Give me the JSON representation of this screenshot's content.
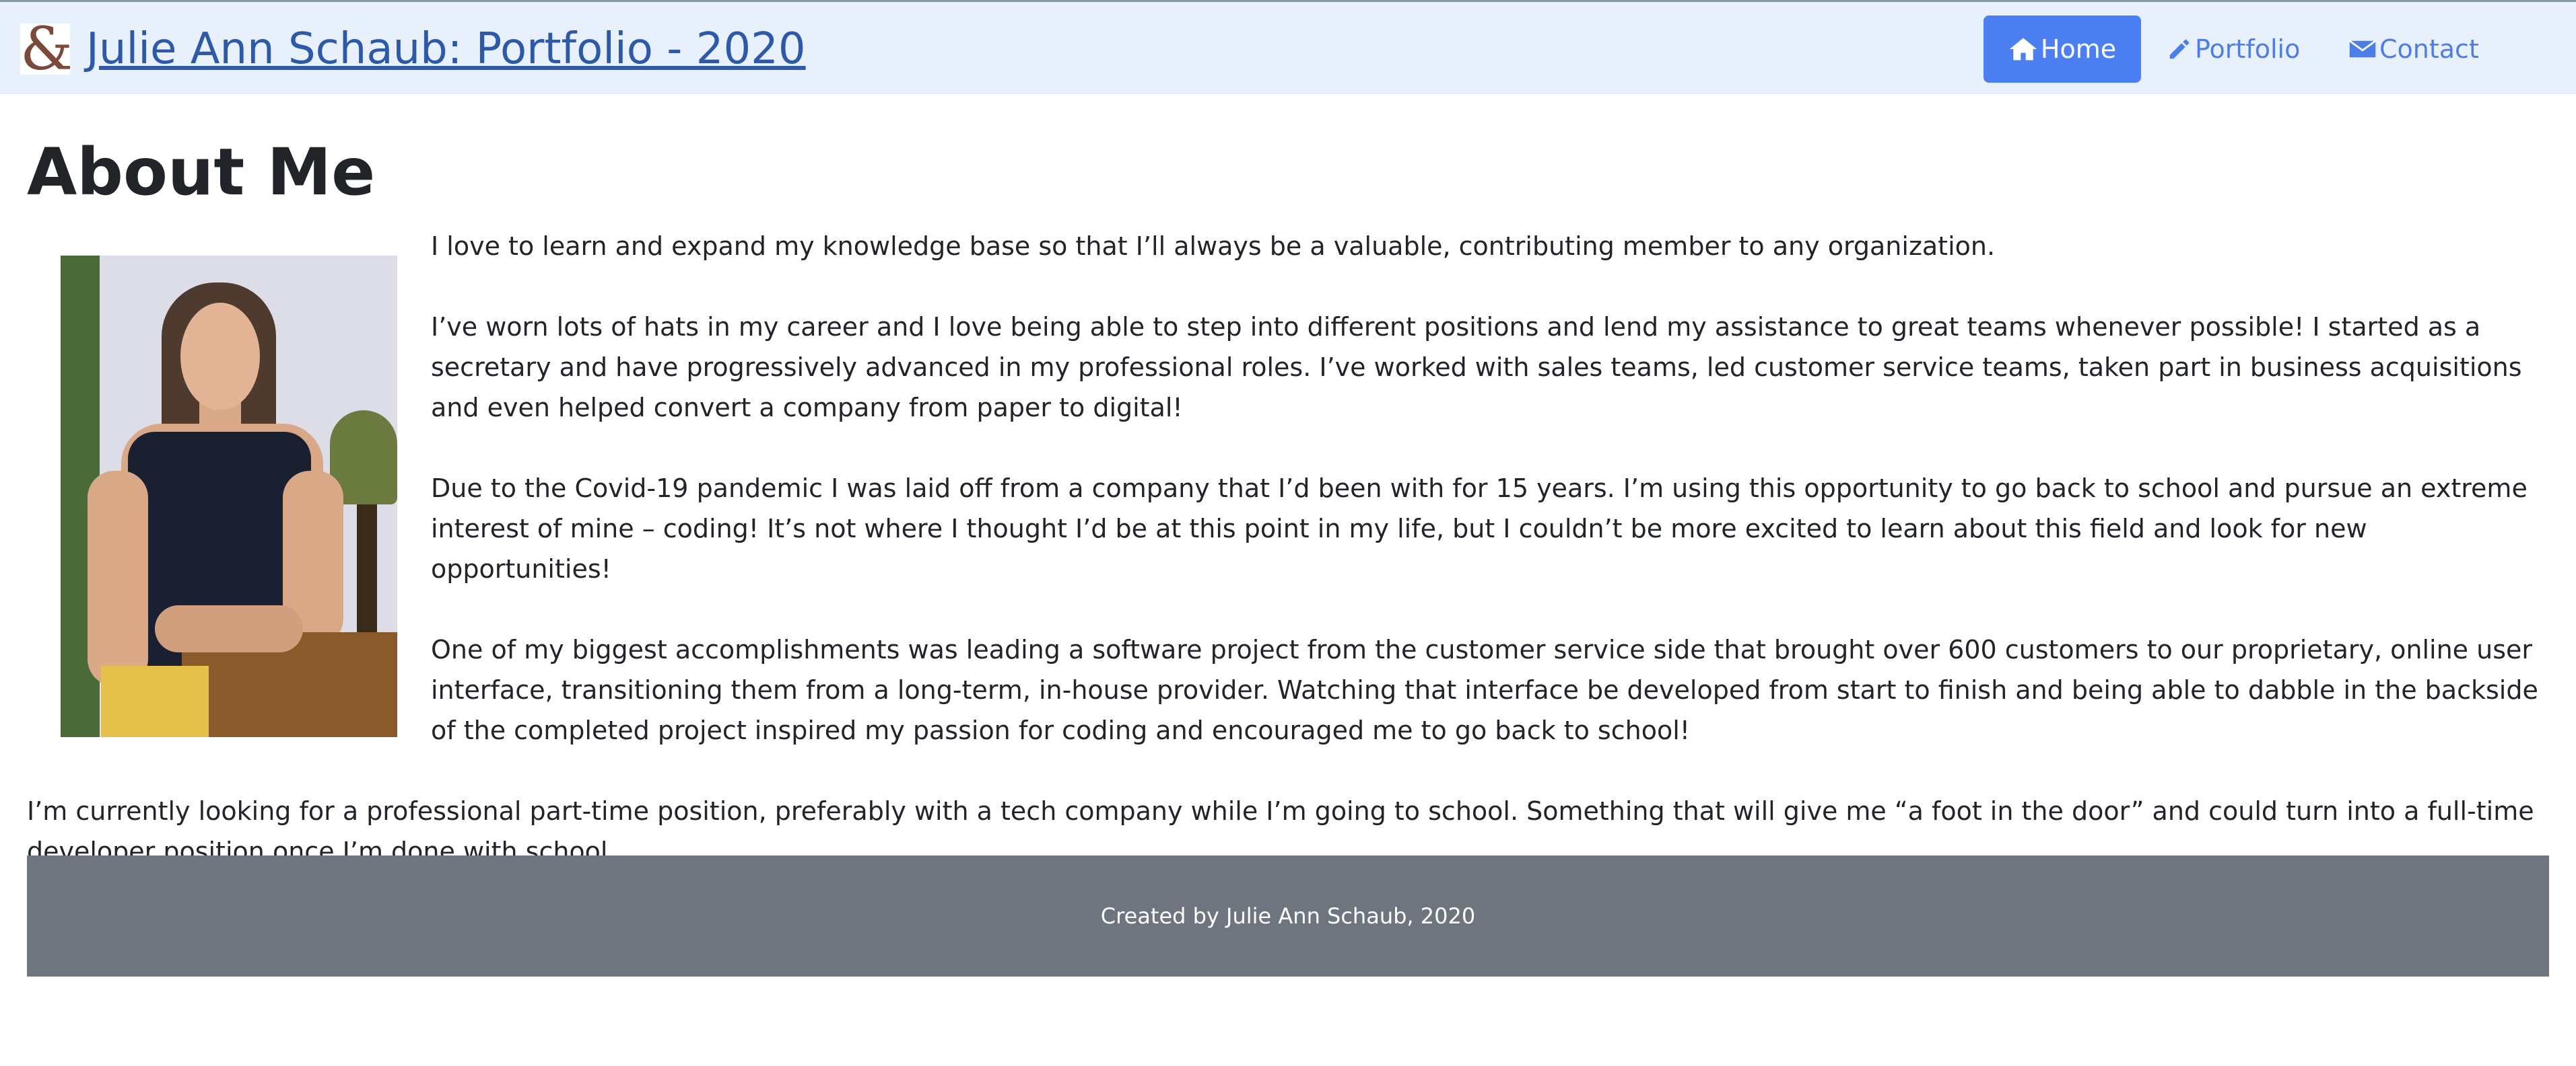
{
  "header": {
    "brand_logo_text": "&",
    "title": "Julie Ann Schaub: Portfolio - 2020"
  },
  "nav": {
    "items": [
      {
        "label": "Home",
        "icon": "home-icon",
        "active": true
      },
      {
        "label": "Portfolio",
        "icon": "pencil-icon",
        "active": false
      },
      {
        "label": "Contact",
        "icon": "envelope-icon",
        "active": false
      }
    ]
  },
  "main": {
    "heading": "About Me",
    "photo_alt": "Photo of Julie Ann Schaub",
    "paragraphs": [
      "I love to learn and expand my knowledge base so that I’ll always be a valuable, contributing member to any organization.",
      "I’ve worn lots of hats in my career and I love being able to step into different positions and lend my assistance to great teams whenever possible! I started as a secretary and have progressively advanced in my professional roles. I’ve worked with sales teams, led customer service teams, taken part in business acquisitions and even helped convert a company from paper to digital!",
      "Due to the Covid-19 pandemic I was laid off from a company that I’d been with for 15 years. I’m using this opportunity to go back to school and pursue an extreme interest of mine – coding! It’s not where I thought I’d be at this point in my life, but I couldn’t be more excited to learn about this field and look for new opportunities!",
      "One of my biggest accomplishments was leading a software project from the customer service side that brought over 600 customers to our proprietary, online user interface, transitioning them from a long-term, in-house provider. Watching that interface be developed from start to finish and being able to dabble in the backside of the completed project inspired my passion for coding and encouraged me to go back to school!",
      "I’m currently looking for a professional part-time position, preferably with a tech company while I’m going to school. Something that will give me “a foot in the door” and could turn into a full-time developer position once I’m done with school."
    ]
  },
  "footer": {
    "text": "Created by Julie Ann Schaub, 2020"
  },
  "colors": {
    "navbar_bg": "#e8f1fb",
    "brand_link": "#2d5aa8",
    "active_nav_bg": "#4c7ff2",
    "nav_link": "#4c7de8",
    "footer_bg": "#6f757e"
  }
}
